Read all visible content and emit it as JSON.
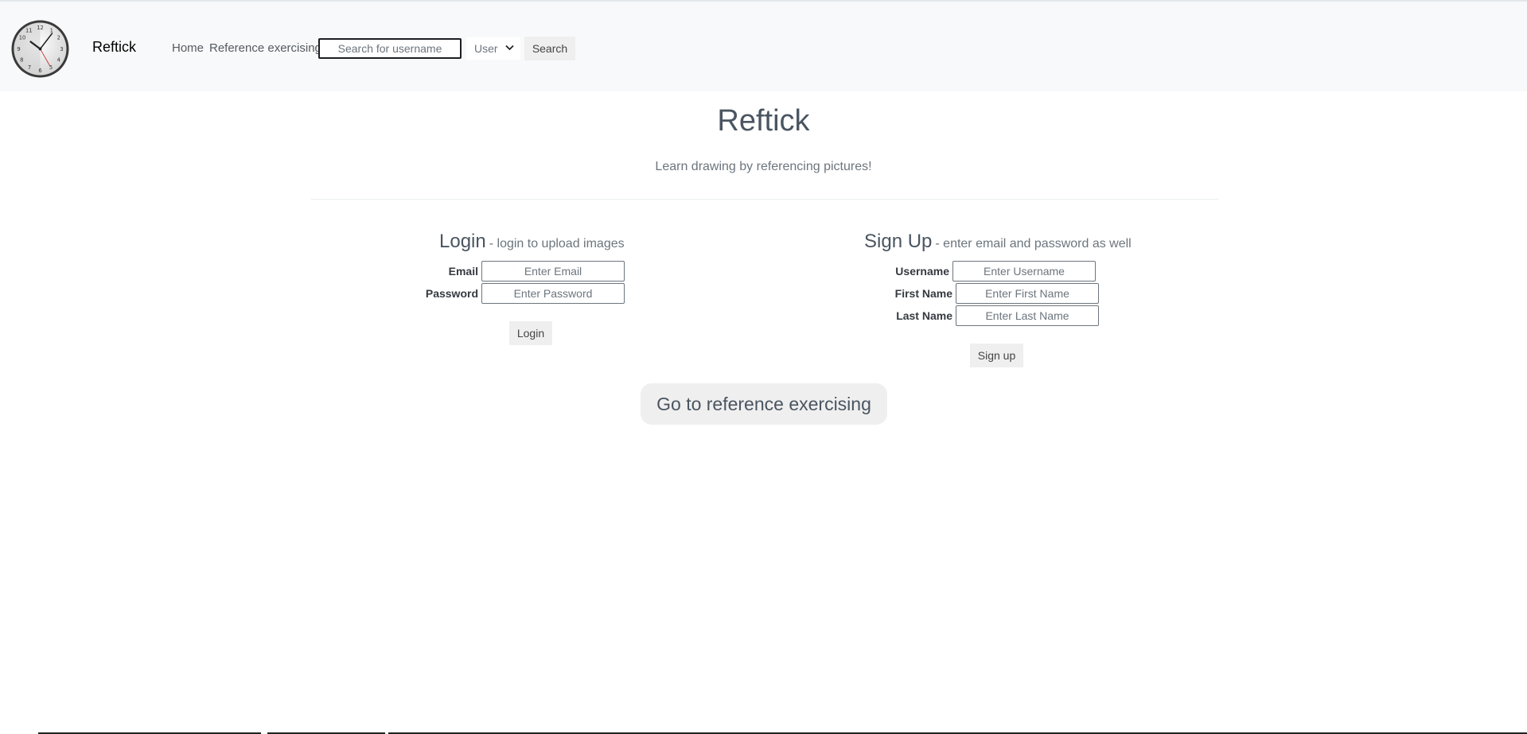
{
  "navbar": {
    "brand": "Reftick",
    "logo_icon": "clock-icon",
    "links": [
      {
        "label": "Home"
      },
      {
        "label": "Reference exercising"
      }
    ],
    "search": {
      "placeholder": "Search for username",
      "value": ""
    },
    "select": {
      "selected": "User",
      "chevron_icon": "chevron-down-icon"
    },
    "search_button": "Search"
  },
  "header": {
    "title": "Reftick",
    "tagline": "Learn drawing by referencing pictures!"
  },
  "login": {
    "heading": "Login",
    "subheading": "- login to upload images",
    "email_label": "Email",
    "email_placeholder": "Enter Email",
    "password_label": "Password",
    "password_placeholder": "Enter Password",
    "button": "Login"
  },
  "signup": {
    "heading": "Sign Up",
    "subheading": "- enter email and password as well",
    "username_label": "Username",
    "username_placeholder": "Enter Username",
    "firstname_label": "First Name",
    "firstname_placeholder": "Enter First Name",
    "lastname_label": "Last Name",
    "lastname_placeholder": "Enter Last Name",
    "button": "Sign up"
  },
  "cta": {
    "label": "Go to reference exercising"
  },
  "colors": {
    "navbar_bg": "#f8f9fa",
    "heading": "#4a5561",
    "muted": "#6c757d",
    "button_bg": "#efefef"
  }
}
